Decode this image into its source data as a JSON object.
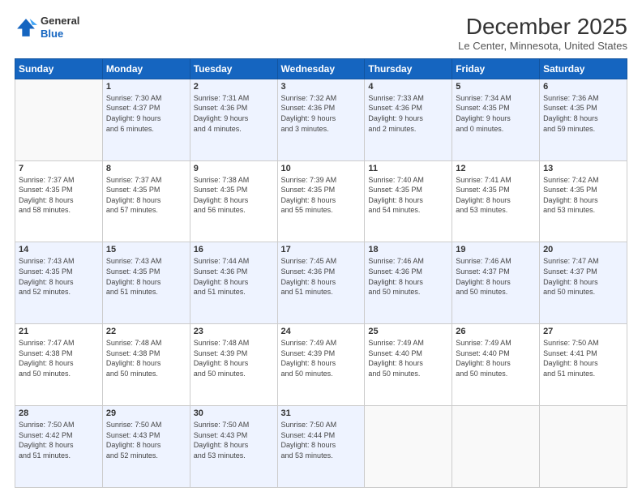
{
  "header": {
    "logo_line1": "General",
    "logo_line2": "Blue",
    "month_title": "December 2025",
    "location": "Le Center, Minnesota, United States"
  },
  "weekdays": [
    "Sunday",
    "Monday",
    "Tuesday",
    "Wednesday",
    "Thursday",
    "Friday",
    "Saturday"
  ],
  "weeks": [
    [
      {
        "day": "",
        "info": ""
      },
      {
        "day": "1",
        "info": "Sunrise: 7:30 AM\nSunset: 4:37 PM\nDaylight: 9 hours\nand 6 minutes."
      },
      {
        "day": "2",
        "info": "Sunrise: 7:31 AM\nSunset: 4:36 PM\nDaylight: 9 hours\nand 4 minutes."
      },
      {
        "day": "3",
        "info": "Sunrise: 7:32 AM\nSunset: 4:36 PM\nDaylight: 9 hours\nand 3 minutes."
      },
      {
        "day": "4",
        "info": "Sunrise: 7:33 AM\nSunset: 4:36 PM\nDaylight: 9 hours\nand 2 minutes."
      },
      {
        "day": "5",
        "info": "Sunrise: 7:34 AM\nSunset: 4:35 PM\nDaylight: 9 hours\nand 0 minutes."
      },
      {
        "day": "6",
        "info": "Sunrise: 7:36 AM\nSunset: 4:35 PM\nDaylight: 8 hours\nand 59 minutes."
      }
    ],
    [
      {
        "day": "7",
        "info": "Sunrise: 7:37 AM\nSunset: 4:35 PM\nDaylight: 8 hours\nand 58 minutes."
      },
      {
        "day": "8",
        "info": "Sunrise: 7:37 AM\nSunset: 4:35 PM\nDaylight: 8 hours\nand 57 minutes."
      },
      {
        "day": "9",
        "info": "Sunrise: 7:38 AM\nSunset: 4:35 PM\nDaylight: 8 hours\nand 56 minutes."
      },
      {
        "day": "10",
        "info": "Sunrise: 7:39 AM\nSunset: 4:35 PM\nDaylight: 8 hours\nand 55 minutes."
      },
      {
        "day": "11",
        "info": "Sunrise: 7:40 AM\nSunset: 4:35 PM\nDaylight: 8 hours\nand 54 minutes."
      },
      {
        "day": "12",
        "info": "Sunrise: 7:41 AM\nSunset: 4:35 PM\nDaylight: 8 hours\nand 53 minutes."
      },
      {
        "day": "13",
        "info": "Sunrise: 7:42 AM\nSunset: 4:35 PM\nDaylight: 8 hours\nand 53 minutes."
      }
    ],
    [
      {
        "day": "14",
        "info": "Sunrise: 7:43 AM\nSunset: 4:35 PM\nDaylight: 8 hours\nand 52 minutes."
      },
      {
        "day": "15",
        "info": "Sunrise: 7:43 AM\nSunset: 4:35 PM\nDaylight: 8 hours\nand 51 minutes."
      },
      {
        "day": "16",
        "info": "Sunrise: 7:44 AM\nSunset: 4:36 PM\nDaylight: 8 hours\nand 51 minutes."
      },
      {
        "day": "17",
        "info": "Sunrise: 7:45 AM\nSunset: 4:36 PM\nDaylight: 8 hours\nand 51 minutes."
      },
      {
        "day": "18",
        "info": "Sunrise: 7:46 AM\nSunset: 4:36 PM\nDaylight: 8 hours\nand 50 minutes."
      },
      {
        "day": "19",
        "info": "Sunrise: 7:46 AM\nSunset: 4:37 PM\nDaylight: 8 hours\nand 50 minutes."
      },
      {
        "day": "20",
        "info": "Sunrise: 7:47 AM\nSunset: 4:37 PM\nDaylight: 8 hours\nand 50 minutes."
      }
    ],
    [
      {
        "day": "21",
        "info": "Sunrise: 7:47 AM\nSunset: 4:38 PM\nDaylight: 8 hours\nand 50 minutes."
      },
      {
        "day": "22",
        "info": "Sunrise: 7:48 AM\nSunset: 4:38 PM\nDaylight: 8 hours\nand 50 minutes."
      },
      {
        "day": "23",
        "info": "Sunrise: 7:48 AM\nSunset: 4:39 PM\nDaylight: 8 hours\nand 50 minutes."
      },
      {
        "day": "24",
        "info": "Sunrise: 7:49 AM\nSunset: 4:39 PM\nDaylight: 8 hours\nand 50 minutes."
      },
      {
        "day": "25",
        "info": "Sunrise: 7:49 AM\nSunset: 4:40 PM\nDaylight: 8 hours\nand 50 minutes."
      },
      {
        "day": "26",
        "info": "Sunrise: 7:49 AM\nSunset: 4:40 PM\nDaylight: 8 hours\nand 50 minutes."
      },
      {
        "day": "27",
        "info": "Sunrise: 7:50 AM\nSunset: 4:41 PM\nDaylight: 8 hours\nand 51 minutes."
      }
    ],
    [
      {
        "day": "28",
        "info": "Sunrise: 7:50 AM\nSunset: 4:42 PM\nDaylight: 8 hours\nand 51 minutes."
      },
      {
        "day": "29",
        "info": "Sunrise: 7:50 AM\nSunset: 4:43 PM\nDaylight: 8 hours\nand 52 minutes."
      },
      {
        "day": "30",
        "info": "Sunrise: 7:50 AM\nSunset: 4:43 PM\nDaylight: 8 hours\nand 53 minutes."
      },
      {
        "day": "31",
        "info": "Sunrise: 7:50 AM\nSunset: 4:44 PM\nDaylight: 8 hours\nand 53 minutes."
      },
      {
        "day": "",
        "info": ""
      },
      {
        "day": "",
        "info": ""
      },
      {
        "day": "",
        "info": ""
      }
    ]
  ]
}
